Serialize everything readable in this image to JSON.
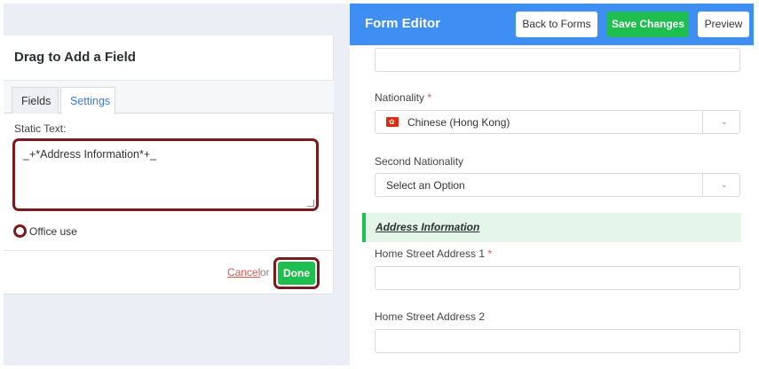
{
  "left_panel": {
    "title": "Drag to Add a Field",
    "tabs": [
      {
        "label": "Fields"
      },
      {
        "label": "Settings"
      }
    ],
    "static_text_label": "Static Text:",
    "static_text_value": "_+*Address Information*+_",
    "office_use_label": "Office use",
    "cancel_label": "Cancel",
    "or_label": "or",
    "done_label": "Done"
  },
  "header": {
    "title": "Form Editor",
    "back_label": "Back to Forms",
    "save_label": "Save Changes",
    "preview_label": "Preview"
  },
  "form": {
    "nationality": {
      "label": "Nationality",
      "required_mark": "*",
      "value": "Chinese (Hong Kong)"
    },
    "second_nationality": {
      "label": "Second Nationality",
      "value": "Select an Option"
    },
    "section_heading": "Address Information",
    "home_street_1": {
      "label": "Home Street Address 1",
      "required_mark": "*"
    },
    "home_street_2": {
      "label": "Home Street Address 2"
    }
  },
  "colors": {
    "header_blue": "#3f8ef4",
    "accent_green": "#1fbf4f",
    "highlight_red": "#7a1a1f",
    "required_red": "#e0534f"
  },
  "icons": {
    "flag": "hong-kong-flag-icon",
    "chevron": "chevron-down-icon"
  }
}
